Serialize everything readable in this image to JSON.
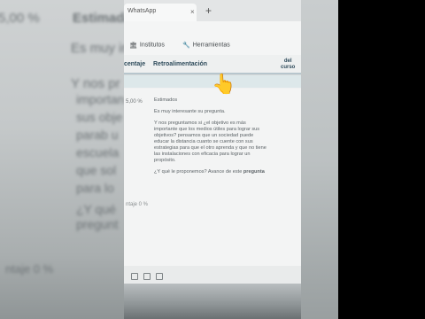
{
  "backdrop": {
    "left_lines": [
      "5,00 %",
      "Estimada",
      "Es muy in",
      "Y nos pr",
      "importan",
      "sus obje",
      "parab u",
      "escuela",
      "que sol",
      "para lo",
      "¿Y qué",
      "pregunt",
      "ntaje 0 %"
    ]
  },
  "browser": {
    "tab_label": "WhatsApp",
    "close_glyph": "×",
    "new_tab_glyph": "+"
  },
  "nav": {
    "institutos_label": "Institutos",
    "herramientas_label": "Herramientas",
    "institutos_icon": "institution-icon",
    "herramientas_icon": "wrench-icon"
  },
  "subnav": {
    "tab1_label": "centaje",
    "tab2_label": "Retroalimentación",
    "tab3_line1": "del",
    "tab3_line2": "curso"
  },
  "row": {
    "percent": "5,00 %",
    "percent2": "ntaje 0 %"
  },
  "feedback": {
    "greeting": "Estimados",
    "p1": "Es muy interesante su pregunta.",
    "p2": "Y nos preguntamos si ¿el objetivo es más importante que los medios útiles para lograr sus objetivos? pensamos que un sociedad puede educar la distancia cuanto se cuente con sus estrategias para que el otro aprenda y que no tiene las instalaciones con eficacia para lograr un propósito.",
    "p3_normal": "¿Y qué le proponemos? Avance de este",
    "p3_bold": "pregunta"
  },
  "overlay": {
    "hand_emoji": "👆"
  }
}
